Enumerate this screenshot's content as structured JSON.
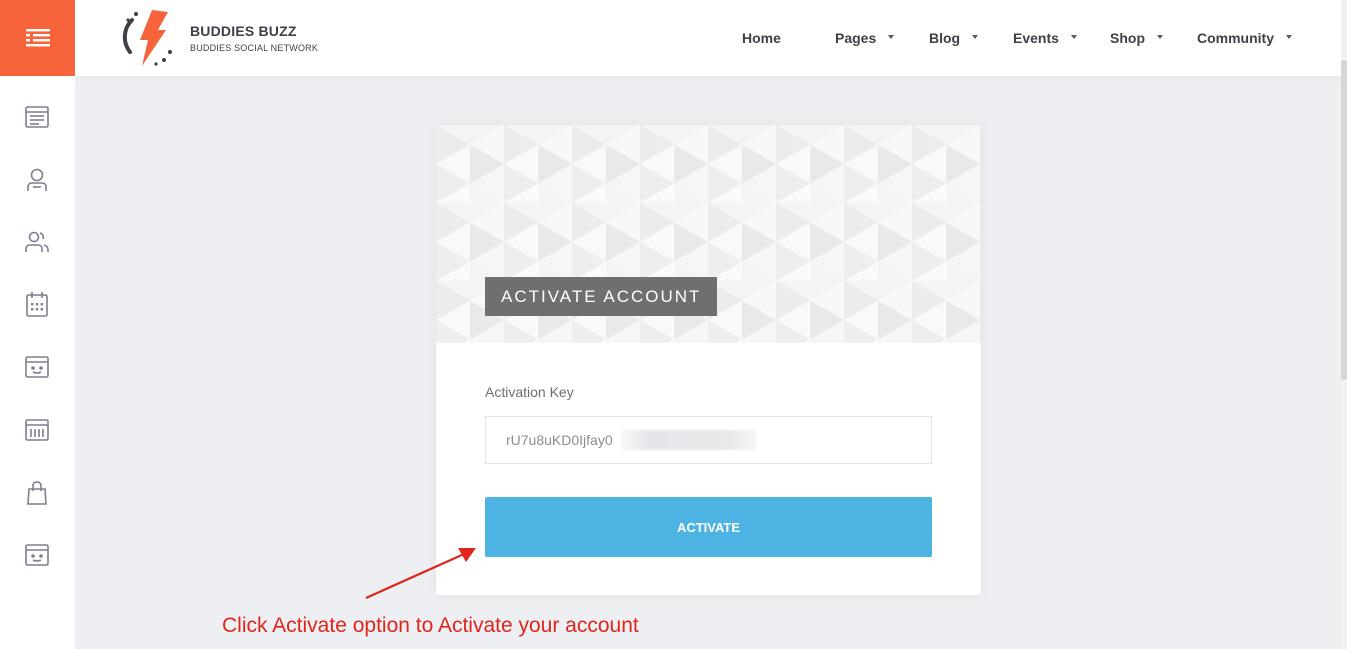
{
  "header": {
    "brand_title": "BUDDIES BUZZ",
    "brand_subtitle": "BUDDIES SOCIAL NETWORK",
    "accent_color": "#f7643b",
    "nav": [
      {
        "label": "Home",
        "has_dropdown": false
      },
      {
        "label": "Pages",
        "has_dropdown": true
      },
      {
        "label": "Blog",
        "has_dropdown": true
      },
      {
        "label": "Events",
        "has_dropdown": true
      },
      {
        "label": "Shop",
        "has_dropdown": true
      },
      {
        "label": "Community",
        "has_dropdown": true
      }
    ]
  },
  "sidebar": {
    "icons": [
      "newsfeed-icon",
      "profile-icon",
      "friends-icon",
      "calendar-icon",
      "groups-icon",
      "forums-icon",
      "shop-bag-icon",
      "widgets-icon"
    ]
  },
  "card": {
    "banner_title": "ACTIVATE ACCOUNT",
    "field_label": "Activation Key",
    "field_value": "rU7u8uKD0Ijfay0",
    "button_label": "ACTIVATE",
    "button_color": "#4cb3e2"
  },
  "annotation": {
    "text": "Click Activate option to Activate your account",
    "color": "#e0261c"
  }
}
